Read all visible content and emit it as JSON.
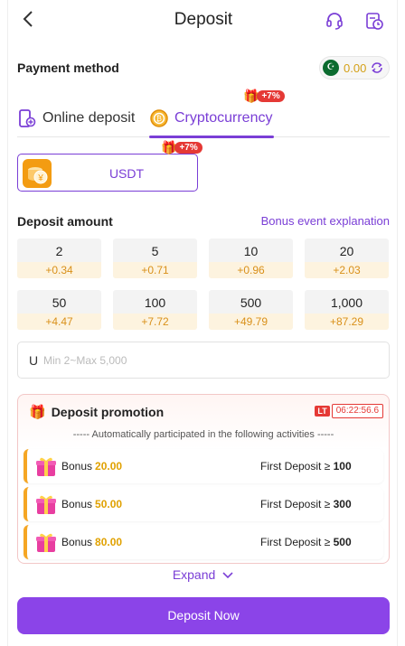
{
  "header": {
    "title": "Deposit"
  },
  "payment": {
    "label": "Payment method",
    "balance": "0.00"
  },
  "tabs": [
    {
      "label": "Online deposit"
    },
    {
      "label": "Cryptocurrency",
      "badge": "+7%"
    }
  ],
  "crypto_option": {
    "label": "USDT",
    "badge": "+7%"
  },
  "deposit": {
    "label": "Deposit amount",
    "bonus_link": "Bonus event explanation",
    "amounts": [
      {
        "value": "2",
        "bonus": "+0.34"
      },
      {
        "value": "5",
        "bonus": "+0.71"
      },
      {
        "value": "10",
        "bonus": "+0.96"
      },
      {
        "value": "20",
        "bonus": "+2.03"
      },
      {
        "value": "50",
        "bonus": "+4.47"
      },
      {
        "value": "100",
        "bonus": "+7.72"
      },
      {
        "value": "500",
        "bonus": "+49.79"
      },
      {
        "value": "1,000",
        "bonus": "+87.29"
      }
    ],
    "input_prefix": "U",
    "input_placeholder": "Min 2~Max 5,000"
  },
  "promotion": {
    "title": "Deposit promotion",
    "timer_tag": "LT",
    "timer": "06:22:56.6",
    "subtitle": "----- Automatically participated in the following activities -----",
    "items": [
      {
        "bonus_label": "Bonus",
        "bonus_amount": "20.00",
        "condition": "First Deposit ≥",
        "condition_value": "100"
      },
      {
        "bonus_label": "Bonus",
        "bonus_amount": "50.00",
        "condition": "First Deposit ≥",
        "condition_value": "300"
      },
      {
        "bonus_label": "Bonus",
        "bonus_amount": "80.00",
        "condition": "First Deposit ≥",
        "condition_value": "500"
      }
    ],
    "expand": "Expand"
  },
  "submit": {
    "label": "Deposit Now"
  },
  "colors": {
    "accent": "#7a3ed6",
    "button": "#8b44e8",
    "bonus": "#d9901a"
  }
}
